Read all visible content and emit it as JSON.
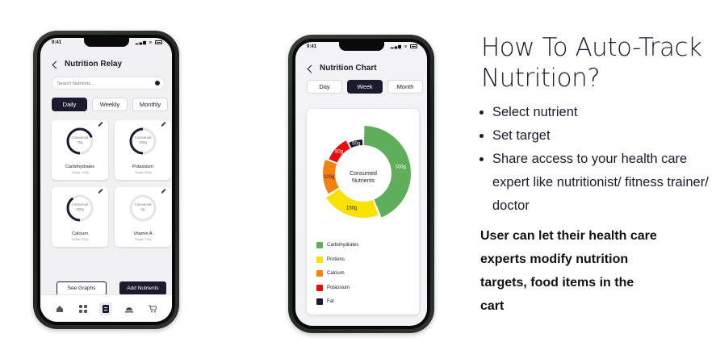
{
  "phone1": {
    "status_time": "9:41",
    "title": "Nutrition Relay",
    "search_placeholder": "Search Nutrients...",
    "tabs": [
      "Daily",
      "Weekly",
      "Monthly"
    ],
    "cards": [
      {
        "label": "Consumed",
        "amount": "70g",
        "name": "Carbohydrates",
        "target": "Target: 100g",
        "progress": 0.7
      },
      {
        "label": "Consumed",
        "amount": "100g",
        "name": "Potassium",
        "target": "Target: 200g",
        "progress": 0.5
      },
      {
        "label": "Consumed",
        "amount": "200g",
        "name": "Calcium",
        "target": "Target: 500g",
        "progress": 0.4
      },
      {
        "label": "Consumed",
        "amount": "0g",
        "name": "Vitamin A",
        "target": "Target: 700g",
        "progress": 0
      }
    ],
    "see_graphs": "See Graphs",
    "add_nutrients": "Add Nutrients",
    "nav_icons": [
      "home-icon",
      "grid-icon",
      "list-icon",
      "food-icon",
      "cart-icon"
    ]
  },
  "phone2": {
    "status_time": "9:41",
    "title": "Nutrition Chart",
    "tabs": [
      "Day",
      "Week",
      "Month"
    ],
    "center_label": "Consumed Nutrients"
  },
  "chart_data": {
    "type": "pie",
    "title": "",
    "center_text": "Consumed Nutrients",
    "categories": [
      "Carbohydrates",
      "Protiens",
      "Calcium",
      "Potassium",
      "Fat"
    ],
    "values": [
      300,
      150,
      100,
      80,
      50
    ],
    "value_labels": [
      "300g",
      "150g",
      "100g",
      "80g",
      "50g"
    ],
    "colors": [
      "#5fae5c",
      "#f9e100",
      "#f5820f",
      "#e80d0d",
      "#1b1a2e"
    ],
    "legend_position": "bottom"
  },
  "info": {
    "heading": "How To Auto-Track Nutrition?",
    "bullets": [
      "Select nutrient",
      "Set target",
      "Share access to your health care expert like nutritionist/ fitness trainer/ doctor"
    ],
    "note": "User can let their health care experts modify nutrition targets, food items in the cart"
  },
  "colors": {
    "dark": "#1b1a2e",
    "ring_track": "#e4e4e8"
  }
}
